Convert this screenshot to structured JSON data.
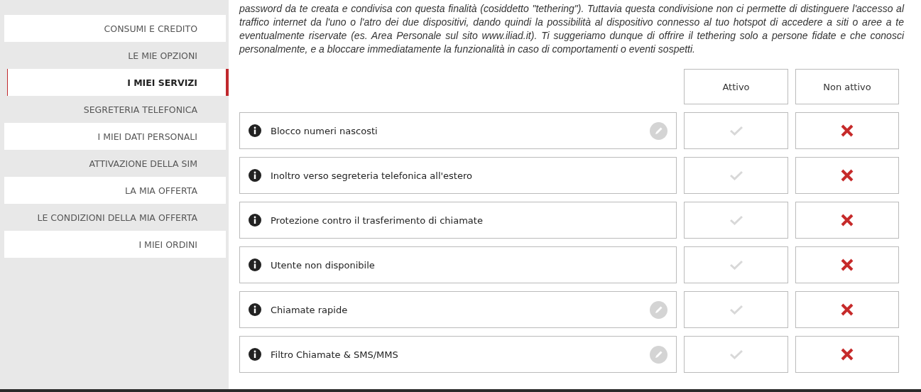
{
  "notice": "password da te creata e condivisa con questa finalità (cosiddetto \"tethering\"). Tuttavia questa condivisione non ci permette di distinguere l'accesso al traffico internet da l'uno o l'atro dei due dispositivi, dando quindi la possibilità al dispositivo connesso al tuo hotspot di accedere a siti o aree a te eventualmente riservate (es. Area Personale sul sito www.iliad.it). Ti suggeriamo dunque di offrire il tethering solo a persone fidate e che conosci personalmente, e a bloccare immediatamente la funzionalità in caso di comportamenti o eventi sospetti.",
  "sidebar": {
    "items": [
      {
        "label": "CONSUMI E CREDITO",
        "selected": false
      },
      {
        "label": "LE MIE OPZIONI",
        "selected": false
      },
      {
        "label": "I MIEI SERVIZI",
        "selected": true
      },
      {
        "label": "SEGRETERIA TELEFONICA",
        "selected": false
      },
      {
        "label": "I MIEI DATI PERSONALI",
        "selected": false
      },
      {
        "label": "ATTIVAZIONE DELLA SIM",
        "selected": false
      },
      {
        "label": "LA MIA OFFERTA",
        "selected": false
      },
      {
        "label": "LE CONDIZIONI DELLA MIA OFFERTA",
        "selected": false
      },
      {
        "label": "I MIEI ORDINI",
        "selected": false
      }
    ]
  },
  "services": {
    "columns": [
      "Attivo",
      "Non attivo"
    ],
    "rows": [
      {
        "name": "Blocco numeri nascosti",
        "active": false,
        "editable": true
      },
      {
        "name": "Inoltro verso segreteria telefonica all'estero",
        "active": false,
        "editable": false
      },
      {
        "name": "Protezione contro il trasferimento di chiamate",
        "active": false,
        "editable": false
      },
      {
        "name": "Utente non disponibile",
        "active": false,
        "editable": false
      },
      {
        "name": "Chiamate rapide",
        "active": false,
        "editable": true
      },
      {
        "name": "Filtro Chiamate & SMS/MMS",
        "active": false,
        "editable": true
      }
    ]
  }
}
